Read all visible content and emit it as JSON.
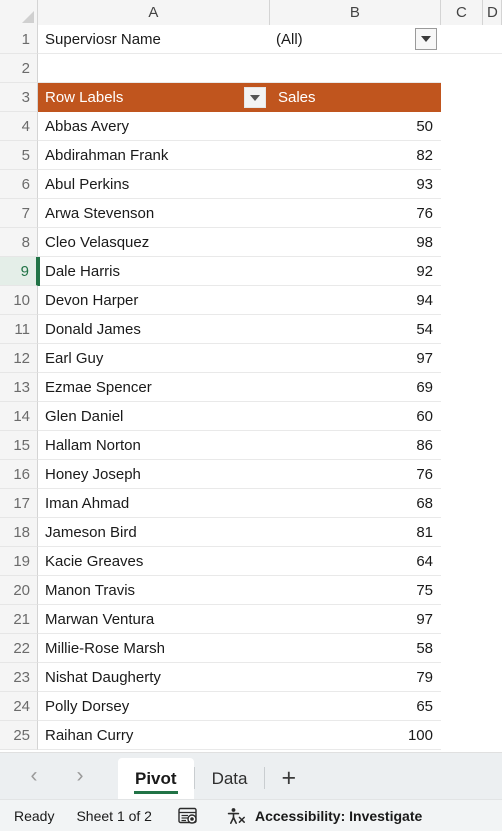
{
  "window": {
    "app": "excel-spreadsheet"
  },
  "grid": {
    "select_all_icon": "select-all-triangle",
    "column_headers": [
      "A",
      "B",
      "C",
      "D"
    ],
    "row_numbers": [
      "1",
      "2",
      "3",
      "4",
      "5",
      "6",
      "7",
      "8",
      "9",
      "10",
      "11",
      "12",
      "13",
      "14",
      "15",
      "16",
      "17",
      "18",
      "19",
      "20",
      "21",
      "22",
      "23",
      "24",
      "25"
    ],
    "active_row": "9",
    "active_cell": "A9",
    "filter": {
      "label": "Superviosr Name",
      "value": "(All)",
      "dropdown_icon": "filter-dropdown-icon"
    },
    "pivot_header": {
      "row_labels": "Row Labels",
      "row_labels_dropdown_icon": "chevron-down-icon",
      "value_field": "Sales",
      "fill_color": "#C0551E",
      "text_color": "#FFFFFF"
    },
    "rows": [
      {
        "row": "4",
        "name": "Abbas Avery",
        "sales": "50"
      },
      {
        "row": "5",
        "name": "Abdirahman Frank",
        "sales": "82"
      },
      {
        "row": "6",
        "name": "Abul Perkins",
        "sales": "93"
      },
      {
        "row": "7",
        "name": "Arwa Stevenson",
        "sales": "76"
      },
      {
        "row": "8",
        "name": "Cleo Velasquez",
        "sales": "98"
      },
      {
        "row": "9",
        "name": "Dale Harris",
        "sales": "92"
      },
      {
        "row": "10",
        "name": "Devon Harper",
        "sales": "94"
      },
      {
        "row": "11",
        "name": "Donald James",
        "sales": "54"
      },
      {
        "row": "12",
        "name": "Earl Guy",
        "sales": "97"
      },
      {
        "row": "13",
        "name": "Ezmae Spencer",
        "sales": "69"
      },
      {
        "row": "14",
        "name": "Glen Daniel",
        "sales": "60"
      },
      {
        "row": "15",
        "name": "Hallam Norton",
        "sales": "86"
      },
      {
        "row": "16",
        "name": "Honey Joseph",
        "sales": "76"
      },
      {
        "row": "17",
        "name": "Iman Ahmad",
        "sales": "68"
      },
      {
        "row": "18",
        "name": "Jameson Bird",
        "sales": "81"
      },
      {
        "row": "19",
        "name": "Kacie Greaves",
        "sales": "64"
      },
      {
        "row": "20",
        "name": "Manon Travis",
        "sales": "75"
      },
      {
        "row": "21",
        "name": "Marwan Ventura",
        "sales": "97"
      },
      {
        "row": "22",
        "name": "Millie-Rose Marsh",
        "sales": "58"
      },
      {
        "row": "23",
        "name": "Nishat Daugherty",
        "sales": "79"
      },
      {
        "row": "24",
        "name": "Polly Dorsey",
        "sales": "65"
      },
      {
        "row": "25",
        "name": "Raihan Curry",
        "sales": "100"
      }
    ]
  },
  "tabbar": {
    "prev_icon": "chevron-left-icon",
    "next_icon": "chevron-right-icon",
    "sheets": [
      {
        "label": "Pivot",
        "active": true
      },
      {
        "label": "Data",
        "active": false
      }
    ],
    "add_sheet_label": "+",
    "active_underline_color": "#217346"
  },
  "statusbar": {
    "mode": "Ready",
    "sheet_count": "Sheet 1 of 2",
    "macro_icon": "record-macro-icon",
    "accessibility_icon": "accessibility-icon",
    "accessibility_text": "Accessibility: Investigate"
  }
}
